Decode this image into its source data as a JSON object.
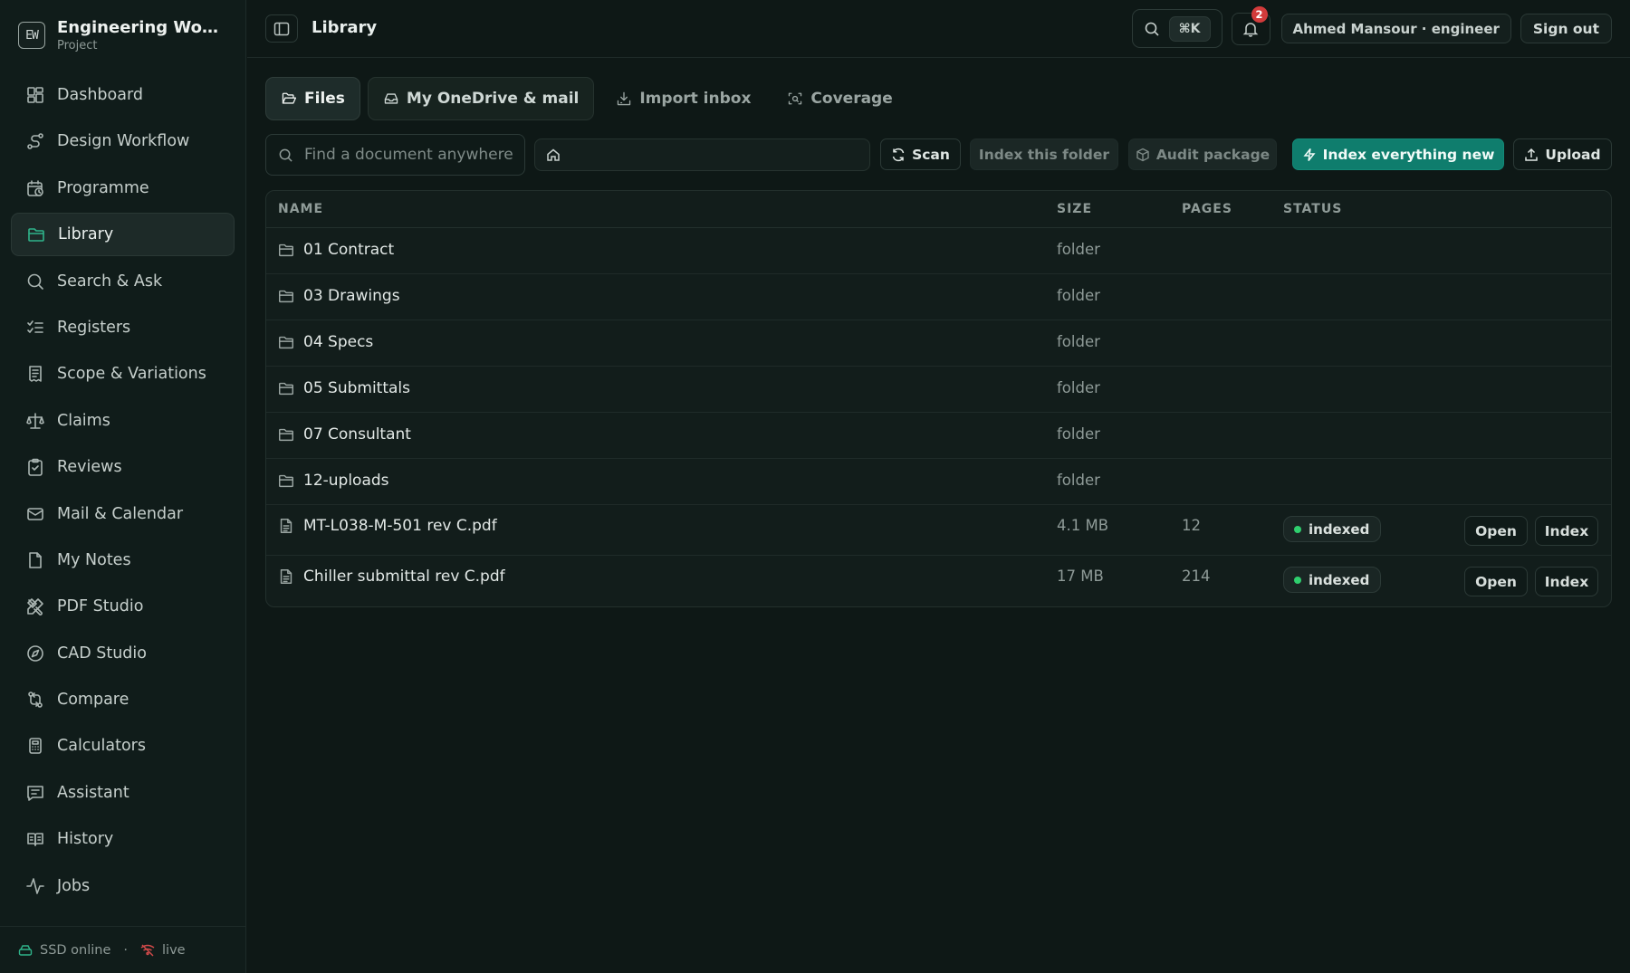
{
  "app": {
    "title": "Engineering Workspace",
    "subtitle": "Project",
    "logo_text": "EW"
  },
  "sidebar": {
    "items": [
      {
        "label": "Dashboard",
        "icon": "dashboard-icon"
      },
      {
        "label": "Design Workflow",
        "icon": "workflow-icon"
      },
      {
        "label": "Programme",
        "icon": "calendar-clock-icon"
      },
      {
        "label": "Library",
        "icon": "folder-icon",
        "active": true
      },
      {
        "label": "Search & Ask",
        "icon": "search-icon"
      },
      {
        "label": "Registers",
        "icon": "list-checks-icon"
      },
      {
        "label": "Scope & Variations",
        "icon": "receipt-icon"
      },
      {
        "label": "Claims",
        "icon": "scale-icon"
      },
      {
        "label": "Reviews",
        "icon": "clipboard-check-icon"
      },
      {
        "label": "Mail & Calendar",
        "icon": "mail-icon"
      },
      {
        "label": "My Notes",
        "icon": "note-icon"
      },
      {
        "label": "PDF Studio",
        "icon": "tools-icon"
      },
      {
        "label": "CAD Studio",
        "icon": "compass-icon"
      },
      {
        "label": "Compare",
        "icon": "git-compare-icon"
      },
      {
        "label": "Calculators",
        "icon": "calculator-icon"
      },
      {
        "label": "Assistant",
        "icon": "message-icon"
      },
      {
        "label": "History",
        "icon": "book-icon"
      },
      {
        "label": "Jobs",
        "icon": "activity-icon"
      }
    ],
    "footer": {
      "storage": "SSD online",
      "separator": "·",
      "live": "live"
    }
  },
  "header": {
    "title": "Library",
    "shortcut": "⌘K",
    "notifications": "2",
    "user": "Ahmed Mansour · engineer",
    "signout": "Sign out"
  },
  "tabs": [
    {
      "label": "Files",
      "icon": "folder-open-icon",
      "state": "active"
    },
    {
      "label": "My OneDrive & mail",
      "icon": "inbox-icon",
      "state": "secondary"
    },
    {
      "label": "Import inbox",
      "icon": "download-icon",
      "state": "plain"
    },
    {
      "label": "Coverage",
      "icon": "scan-icon",
      "state": "plain"
    }
  ],
  "toolbar": {
    "search_placeholder": "Find a document anywhere",
    "path_icon": "home-icon",
    "scan": "Scan",
    "index_folder": "Index this folder",
    "audit": "Audit package",
    "index_new": "Index everything new",
    "upload": "Upload"
  },
  "table": {
    "columns": [
      "NAME",
      "SIZE",
      "PAGES",
      "STATUS"
    ],
    "rows": [
      {
        "name": "01 Contract",
        "type": "folder",
        "size": "folder",
        "pages": "",
        "status": ""
      },
      {
        "name": "03 Drawings",
        "type": "folder",
        "size": "folder",
        "pages": "",
        "status": ""
      },
      {
        "name": "04 Specs",
        "type": "folder",
        "size": "folder",
        "pages": "",
        "status": ""
      },
      {
        "name": "05 Submittals",
        "type": "folder",
        "size": "folder",
        "pages": "",
        "status": ""
      },
      {
        "name": "07 Consultant",
        "type": "folder",
        "size": "folder",
        "pages": "",
        "status": ""
      },
      {
        "name": "12-uploads",
        "type": "folder",
        "size": "folder",
        "pages": "",
        "status": ""
      },
      {
        "name": "MT-L038-M-501 rev C.pdf",
        "type": "file",
        "size": "4.1 MB",
        "pages": "12",
        "status": "indexed",
        "actions": [
          "Open",
          "Index"
        ]
      },
      {
        "name": "Chiller submittal rev C.pdf",
        "type": "file",
        "size": "17 MB",
        "pages": "214",
        "status": "indexed",
        "actions": [
          "Open",
          "Index"
        ]
      }
    ]
  }
}
